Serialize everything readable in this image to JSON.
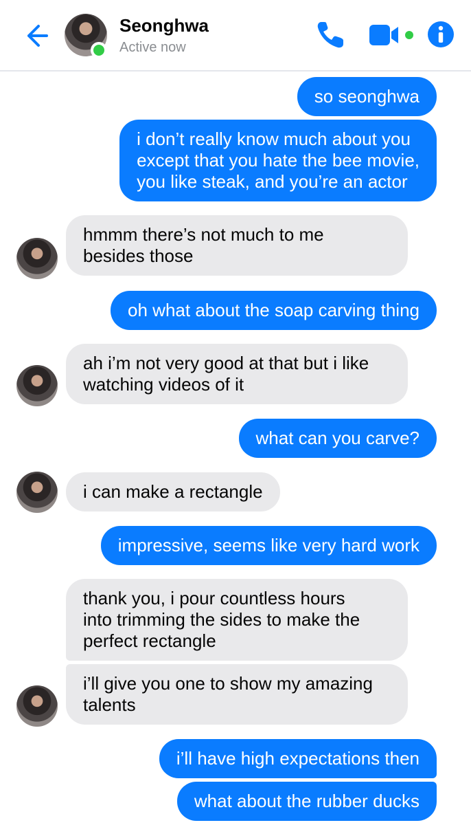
{
  "header": {
    "name": "Seonghwa",
    "status": "Active now"
  },
  "icons": {
    "back": "back-arrow-icon",
    "call": "phone-icon",
    "video": "video-camera-icon",
    "info": "info-icon"
  },
  "colors": {
    "accent": "#0a7cff",
    "incoming_bubble": "#e9e9eb",
    "online": "#31cc46"
  },
  "messages": [
    {
      "side": "out",
      "lines": [
        "so seonghwa"
      ]
    },
    {
      "side": "out",
      "lines": [
        "i don’t really know much about you",
        "except that you hate the bee movie,",
        "you like steak, and you’re an actor"
      ]
    },
    {
      "side": "in",
      "lines": [
        "hmmm there’s not much to me",
        "besides those"
      ]
    },
    {
      "side": "out",
      "lines": [
        "oh what about the soap carving thing"
      ]
    },
    {
      "side": "in",
      "lines": [
        "ah i’m not very good at that but i like",
        "watching videos of it"
      ]
    },
    {
      "side": "out",
      "lines": [
        "what can you carve?"
      ]
    },
    {
      "side": "in",
      "lines": [
        "i can make a rectangle"
      ]
    },
    {
      "side": "out",
      "lines": [
        "impressive, seems like very hard work"
      ]
    },
    {
      "side": "in",
      "lines": [
        "thank you, i pour countless hours",
        "into trimming the sides to make the",
        "perfect rectangle"
      ]
    },
    {
      "side": "in",
      "lines": [
        "i’ll give you one to show my amazing",
        "talents"
      ]
    },
    {
      "side": "out",
      "lines": [
        "i’ll have high expectations then"
      ]
    },
    {
      "side": "out",
      "lines": [
        "what about the rubber ducks"
      ]
    }
  ]
}
